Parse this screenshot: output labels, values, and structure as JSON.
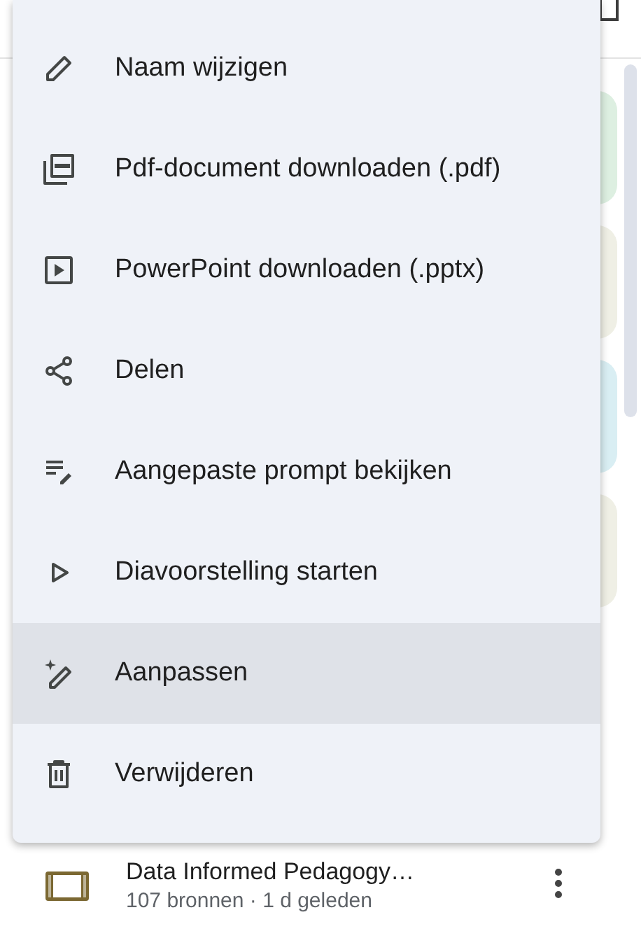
{
  "menu": {
    "items": [
      {
        "label": "Naam wijzigen",
        "selected": false
      },
      {
        "label": "Pdf-document downloaden (.pdf)",
        "selected": false
      },
      {
        "label": "PowerPoint downloaden (.pptx)",
        "selected": false
      },
      {
        "label": "Delen",
        "selected": false
      },
      {
        "label": "Aangepaste prompt bekijken",
        "selected": false
      },
      {
        "label": "Diavoorstelling starten",
        "selected": false
      },
      {
        "label": "Aanpassen",
        "selected": true
      },
      {
        "label": "Verwijderen",
        "selected": false
      }
    ]
  },
  "background_cards": [
    {
      "color": "#ddefe1"
    },
    {
      "color": "#efefe5"
    },
    {
      "color": "#d9eef3"
    },
    {
      "color": "#efefe5"
    }
  ],
  "list_item": {
    "title": "Data Informed Pedagogy…",
    "subtitle": "107 bronnen · 1 d geleden"
  }
}
